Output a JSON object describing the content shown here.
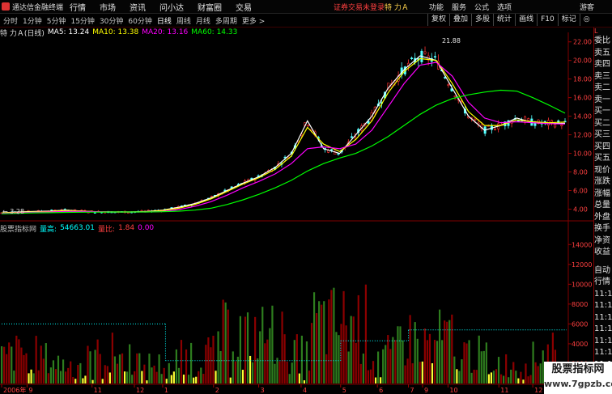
{
  "menubar": {
    "app_title": "通达信金融终端",
    "items": [
      "行情",
      "市场",
      "资讯",
      "问小达",
      "财富圈",
      "交易"
    ],
    "notice": "证券交易未登录",
    "stock_name": "特 力Ａ",
    "right_items": [
      "功能",
      "服务",
      "公式",
      "选项"
    ],
    "guest": "游客"
  },
  "periods": {
    "tabs": [
      "分时",
      "1分钟",
      "5分钟",
      "15分钟",
      "30分钟",
      "60分钟",
      "日线",
      "周线",
      "月线",
      "多周期",
      "更多 >"
    ],
    "active_index": 6
  },
  "toolbar": {
    "items": [
      "复权",
      "叠加",
      "多股",
      "统计",
      "画线",
      "F10",
      "标记",
      "◎"
    ]
  },
  "chart_header": {
    "name": "特 力Ａ(日线)",
    "ma5": "MA5: 13.24",
    "ma10": "MA10: 13.38",
    "ma20": "MA20: 13.16",
    "ma60": "MA60: 14.33",
    "colors": {
      "ma5": "#ffffff",
      "ma10": "#ffff00",
      "ma20": "#ff00ff",
      "ma60": "#00ff00"
    }
  },
  "volume_header": {
    "indicator": "股票指标网",
    "lianghe_label": "量高:",
    "lianghe_value": "54663.01",
    "liangbi_label": "量比:",
    "liangbi_value": "1.84",
    "liangbi_value2": "0.00"
  },
  "annotations": {
    "high": "21.88",
    "low": "← 3.28"
  },
  "price_axis": [
    "22.00",
    "20.00",
    "18.00",
    "16.00",
    "14.00",
    "12.00",
    "10.00",
    "8.00",
    "6.00",
    "4.00"
  ],
  "volume_axis": [
    "14000",
    "12000",
    "10000",
    "8000",
    "6000",
    "4000",
    "2000"
  ],
  "x_axis": [
    "2006年",
    "9",
    "11",
    "12",
    "1",
    "2",
    "3",
    "4",
    "5",
    "6",
    "7",
    "9",
    "10",
    "11",
    "12"
  ],
  "right_panel": {
    "code_label": "L",
    "items": [
      "委比",
      "卖五",
      "卖四",
      "卖三",
      "卖二",
      "卖一",
      "买一",
      "买二",
      "买三",
      "买四",
      "买五",
      "现价",
      "涨跌",
      "涨幅",
      "总量",
      "外盘",
      "换手",
      "净资",
      "收益"
    ],
    "lower_items": [
      "自动",
      "行情",
      "11:1",
      "11:1",
      "11:1",
      "11:1",
      "11:1",
      "11:1",
      "11:1",
      "11:1",
      "11:1"
    ]
  },
  "watermark": {
    "line1": "股票指标网",
    "line2": "www.7gpzb.com"
  },
  "chart_data": {
    "type": "line",
    "title": "特 力Ａ(日线)",
    "ylim": [
      3,
      22.5
    ],
    "price_series": [
      {
        "name": "MA5",
        "color": "#ffffff",
        "values": [
          3.6,
          3.7,
          3.75,
          3.8,
          3.9,
          3.8,
          3.7,
          3.7,
          3.7,
          3.75,
          3.9,
          4.2,
          4.6,
          5.2,
          6,
          6.8,
          7.5,
          8.5,
          10,
          13.5,
          10.5,
          10,
          12,
          14,
          17,
          19,
          20.5,
          20,
          17,
          14,
          12.5,
          13,
          13.8,
          13.3,
          13.2,
          13.24
        ]
      },
      {
        "name": "MA10",
        "color": "#ffff00",
        "values": [
          3.6,
          3.65,
          3.7,
          3.75,
          3.85,
          3.8,
          3.72,
          3.7,
          3.7,
          3.72,
          3.85,
          4.1,
          4.5,
          5.1,
          5.9,
          6.7,
          7.4,
          8.3,
          9.7,
          12.8,
          11,
          10.2,
          11.5,
          13.5,
          16.5,
          18.8,
          20.2,
          20,
          17.5,
          14.5,
          13,
          13,
          13.6,
          13.4,
          13.3,
          13.38
        ]
      },
      {
        "name": "MA20",
        "color": "#ff00ff",
        "values": [
          3.55,
          3.6,
          3.65,
          3.7,
          3.75,
          3.75,
          3.72,
          3.7,
          3.7,
          3.7,
          3.75,
          3.95,
          4.3,
          4.8,
          5.5,
          6.3,
          7,
          7.8,
          8.9,
          10.5,
          10.7,
          10.5,
          11,
          12.5,
          15,
          17.5,
          19.5,
          19.8,
          18.3,
          15.5,
          13.8,
          13.3,
          13.4,
          13.3,
          13.2,
          13.16
        ]
      },
      {
        "name": "MA60",
        "color": "#00ff00",
        "values": [
          3.5,
          3.55,
          3.6,
          3.62,
          3.65,
          3.67,
          3.68,
          3.7,
          3.7,
          3.7,
          3.72,
          3.78,
          3.9,
          4.1,
          4.5,
          5,
          5.6,
          6.3,
          7.1,
          8.1,
          8.9,
          9.5,
          10,
          10.8,
          11.8,
          13,
          14.2,
          15.2,
          15.9,
          16.3,
          16.6,
          16.8,
          16.7,
          16,
          15.2,
          14.33
        ]
      }
    ],
    "volume_ylim": [
      0,
      15000
    ],
    "volume_thresholds": [
      {
        "from": 0,
        "to": 0.29,
        "value": 6000
      },
      {
        "from": 0.29,
        "to": 0.6,
        "value": 2300
      },
      {
        "from": 0.6,
        "to": 0.72,
        "value": 4300
      },
      {
        "from": 0.72,
        "to": 1.0,
        "value": 5400
      }
    ]
  }
}
